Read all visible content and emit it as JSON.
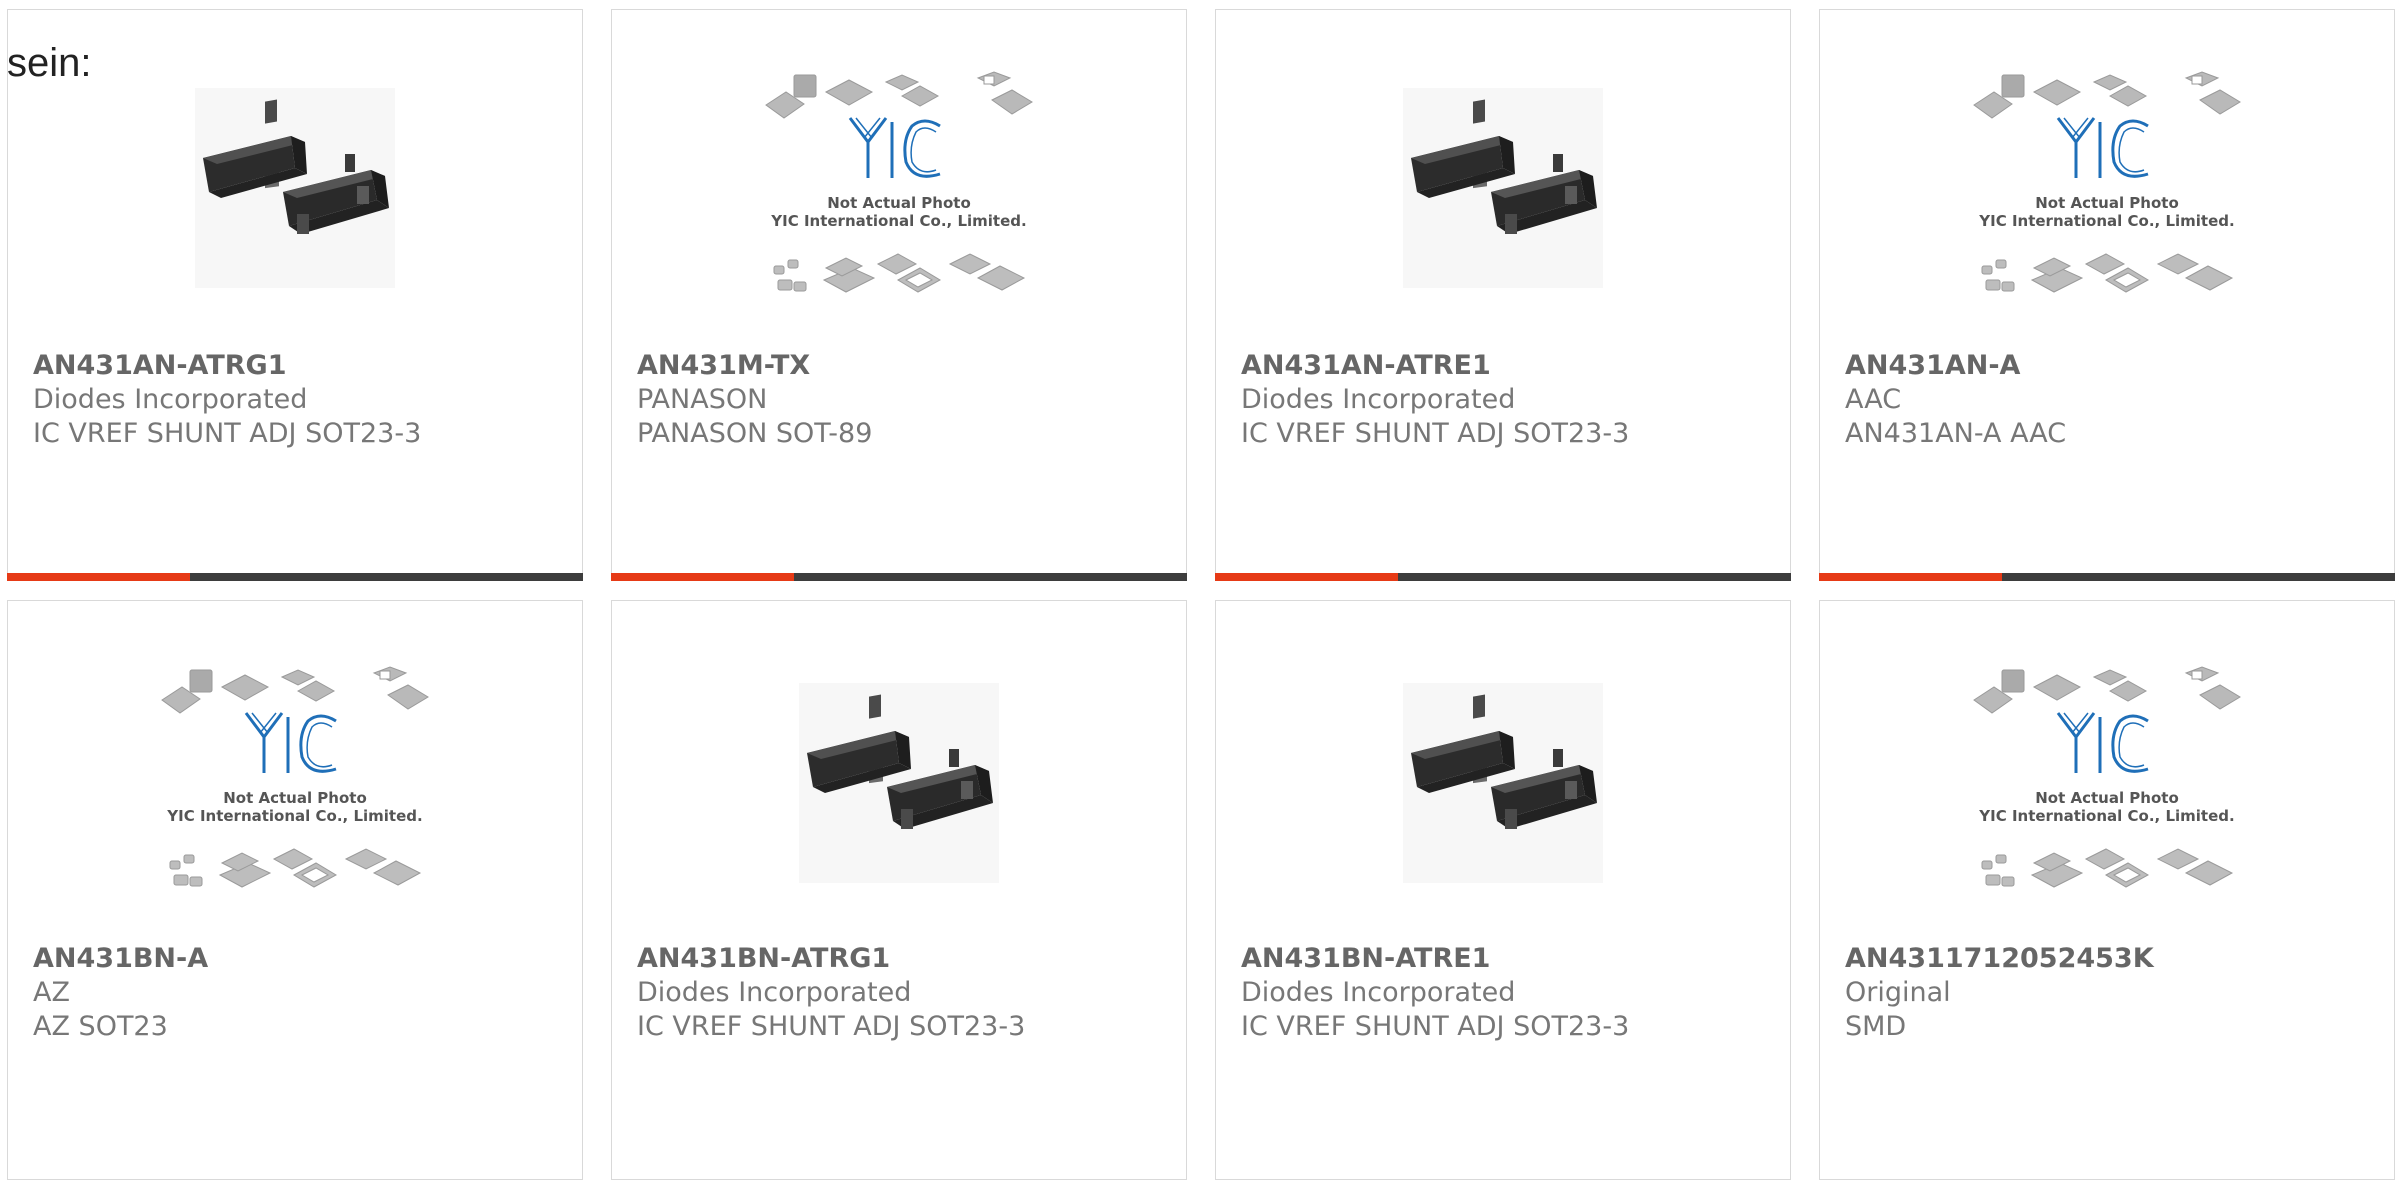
{
  "lead_text": "sein:",
  "colors": {
    "accent": "#e63a16",
    "bar": "#3d3d3d",
    "border": "#d9d9d9",
    "text": "#777777",
    "logo_blue": "#1f6fb8"
  },
  "stock_photo": {
    "caption_line1": "Not Actual Photo",
    "caption_line2": "YIC International Co., Limited.",
    "logo": "YIC"
  },
  "products": [
    {
      "part_no": "AN431AN-ATRG1",
      "brand": "Diodes Incorporated",
      "desc": "IC VREF SHUNT ADJ SOT23-3",
      "image": "sot23-chip"
    },
    {
      "part_no": "AN431M-TX",
      "brand": "PANASON",
      "desc": "PANASON SOT-89",
      "image": "not-actual-photo"
    },
    {
      "part_no": "AN431AN-ATRE1",
      "brand": "Diodes Incorporated",
      "desc": "IC VREF SHUNT ADJ SOT23-3",
      "image": "sot23-chip"
    },
    {
      "part_no": "AN431AN-A",
      "brand": "AAC",
      "desc": "AN431AN-A AAC",
      "image": "not-actual-photo"
    },
    {
      "part_no": "AN431BN-A",
      "brand": "AZ",
      "desc": "AZ SOT23",
      "image": "not-actual-photo"
    },
    {
      "part_no": "AN431BN-ATRG1",
      "brand": "Diodes Incorporated",
      "desc": "IC VREF SHUNT ADJ SOT23-3",
      "image": "sot23-chip"
    },
    {
      "part_no": "AN431BN-ATRE1",
      "brand": "Diodes Incorporated",
      "desc": "IC VREF SHUNT ADJ SOT23-3",
      "image": "sot23-chip"
    },
    {
      "part_no": "AN4311712052453K",
      "brand": "Original",
      "desc": "SMD",
      "image": "not-actual-photo"
    }
  ]
}
